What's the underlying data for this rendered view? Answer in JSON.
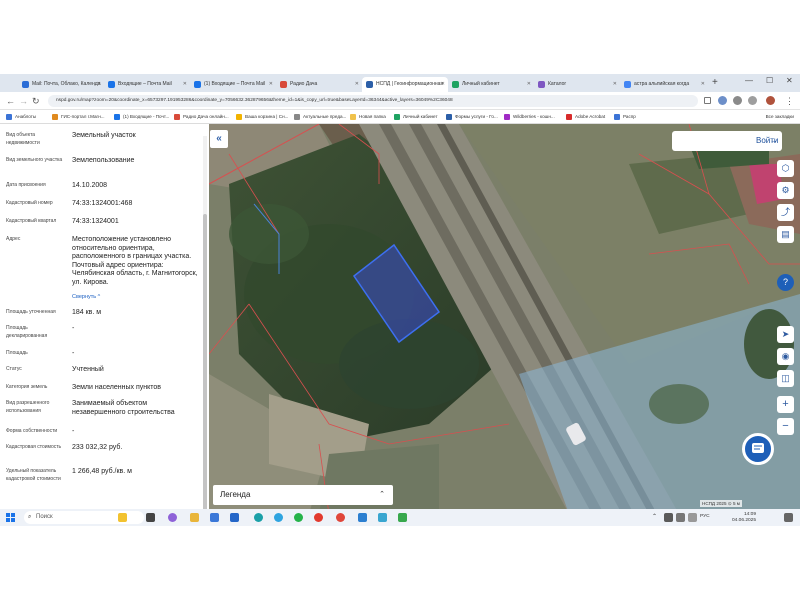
{
  "browser": {
    "tabs": [
      {
        "label": "Mail: Почта, Облако, Календа",
        "color": "#2b6dd6"
      },
      {
        "label": "Входящие – Почта Mail",
        "color": "#1a73e8"
      },
      {
        "label": "(1) Входящие – Почта Mail",
        "color": "#1a73e8"
      },
      {
        "label": "Радио Дача",
        "color": "#d84a3a"
      },
      {
        "label": "НСПД | Геоинформационная",
        "color": "#2c5fa8"
      },
      {
        "label": "Личный кабинет",
        "color": "#1ea362"
      },
      {
        "label": "Каталог",
        "color": "#7e57c2"
      },
      {
        "label": "астра альпийская когда",
        "color": "#4285f4"
      }
    ],
    "new_tab": "+",
    "url": "nspd.gov.ru/map?zoom=20&coordinate_x=6573297.191953286&coordinate_y=7056632.362879656&theme_id=1&is_copy_url=true&baseLayerId=36344&active_layers=36049%2C36048",
    "bookmarks": [
      {
        "label": "Анаблоты",
        "color": "#3b73d6"
      },
      {
        "label": "ГИС-портал г.Магн...",
        "color": "#e08a1e"
      },
      {
        "label": "(1) Входящие - Почт...",
        "color": "#1a73e8"
      },
      {
        "label": "Радио Дача онлайн...",
        "color": "#d84a3a"
      },
      {
        "label": "Ваша корзина | Сн...",
        "color": "#f2b300"
      },
      {
        "label": "Актуальные преда...",
        "color": "#888888"
      },
      {
        "label": "Новая папка",
        "color": "#f0c24b"
      },
      {
        "label": "Личный кабинет",
        "color": "#1ea362"
      },
      {
        "label": "Формы услуги - Го...",
        "color": "#2c5fa8"
      },
      {
        "label": "Wildberries - кошн...",
        "color": "#a02ac5"
      },
      {
        "label": "Adobe Acrobat",
        "color": "#d82b2b"
      },
      {
        "label": "Распр",
        "color": "#3b73d6"
      }
    ],
    "bookmarks_right": "Все закладки"
  },
  "panel": {
    "fields": [
      {
        "label": "Вид объекта недвижимости",
        "value": "Земельный участок"
      },
      {
        "label": "Вид земельного участка",
        "value": "Землепользование"
      },
      {
        "label": "Дата присвоения",
        "value": "14.10.2008"
      },
      {
        "label": "Кадастровый номер",
        "value": "74:33:1324001:468"
      },
      {
        "label": "Кадастровый квартал",
        "value": "74:33:1324001"
      },
      {
        "label": "Адрес",
        "value": "Местоположение установлено относительно ориентира, расположенного в границах участка. Почтовый адрес ориентира: Челябинская область, г. Магнитогорск, ул. Кирова."
      },
      {
        "label": "Площадь уточненная",
        "value": "184 кв. м"
      },
      {
        "label": "Площадь декларированная",
        "value": "-"
      },
      {
        "label": "Площадь",
        "value": "-"
      },
      {
        "label": "Статус",
        "value": "Учтенный"
      },
      {
        "label": "Категория земель",
        "value": "Земли населенных пунктов"
      },
      {
        "label": "Вид разрешенного использования",
        "value": "Занимаемый объектом незавершенного строительства"
      },
      {
        "label": "Форма собственности",
        "value": "-"
      },
      {
        "label": "Кадастровая стоимость",
        "value": "233 032,32 руб."
      },
      {
        "label": "Удельный показатель кадастровой стоимости",
        "value": "1 266,48 руб./кв. м"
      }
    ],
    "collapse_link": "Свернуть ^"
  },
  "map": {
    "collapse_button": "«",
    "login": "Войти",
    "legend": "Легенда",
    "legend_arrow": "⌃",
    "scale": "НСПД 2025 ⊙ 5 м",
    "plot_color": "#3b4cf0"
  },
  "taskbar": {
    "search": "Поиск",
    "lang": "РУС",
    "time": "14:09",
    "date": "04.06.2025"
  }
}
